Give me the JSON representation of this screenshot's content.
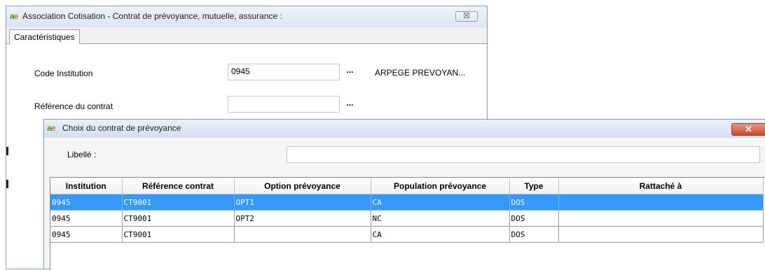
{
  "app_logo": "ae",
  "main_window": {
    "title": "Association Cotisation - Contrat de prévoyance, mutuelle, assurance :",
    "close_glyph": "☒",
    "tabs": [
      {
        "label": "Caractéristiques"
      }
    ],
    "fields": {
      "code_institution": {
        "label": "Code Institution",
        "value": "0945",
        "lookup": "...",
        "description": "ARPEGE PREVOYAN..."
      },
      "reference_contrat": {
        "label": "Référence du contrat",
        "value": "",
        "lookup": "..."
      }
    }
  },
  "dialog": {
    "title": "Choix du contrat de prévoyance",
    "close_glyph": "✕",
    "filter": {
      "label": "Libellé :",
      "value": ""
    },
    "table": {
      "columns": [
        "Institution",
        "Référence contrat",
        "Option prévoyance",
        "Population prévoyance",
        "Type",
        "Rattaché à"
      ],
      "rows": [
        {
          "institution": "0945",
          "reference": "CT9001",
          "option": "OPT1",
          "population": "CA",
          "type": "DOS",
          "rattache": "",
          "selected": true
        },
        {
          "institution": "0945",
          "reference": "CT9001",
          "option": "OPT2",
          "population": "NC",
          "type": "DOS",
          "rattache": "",
          "selected": false
        },
        {
          "institution": "0945",
          "reference": "CT9001",
          "option": "",
          "population": "CA",
          "type": "DOS",
          "rattache": "",
          "selected": false
        }
      ]
    }
  },
  "colors": {
    "selection": "#3399ff",
    "close_button": "#c94a2c"
  }
}
